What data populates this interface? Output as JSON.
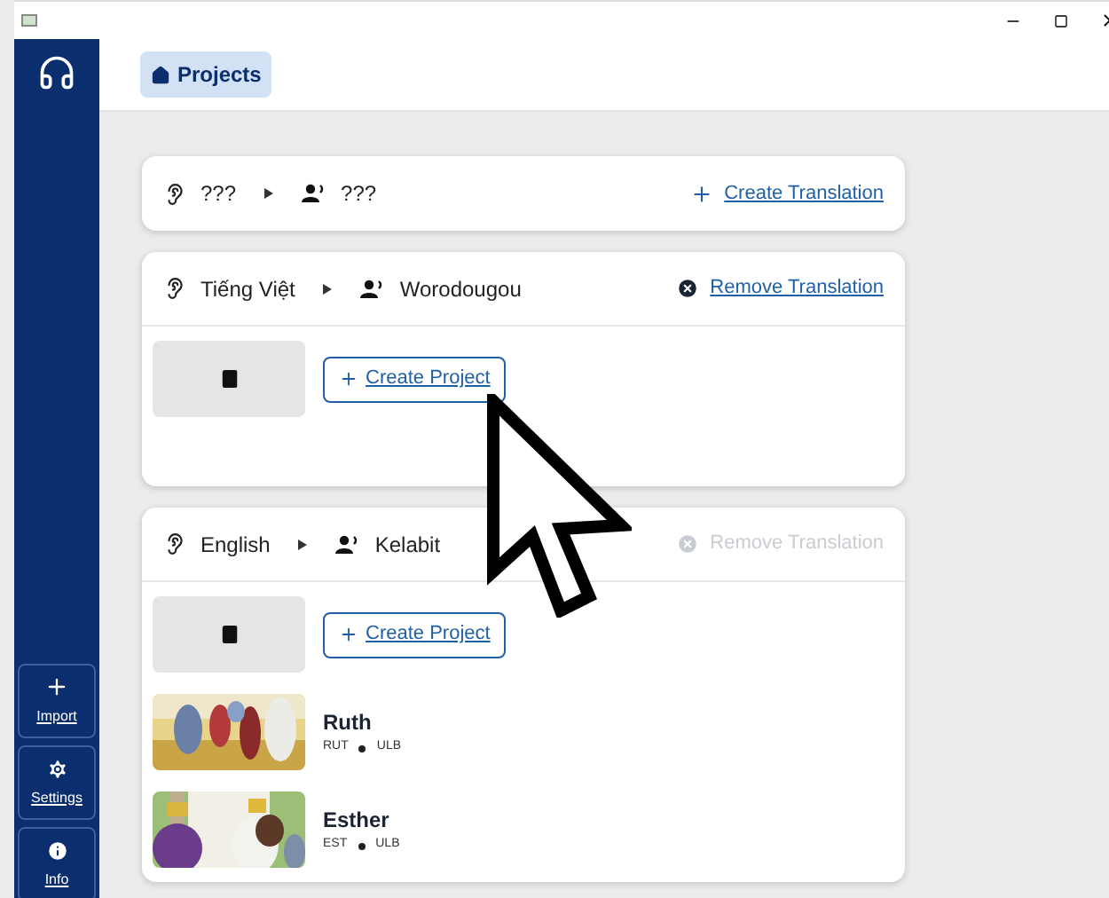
{
  "header": {
    "nav_button": "Projects"
  },
  "sidebar": {
    "buttons": [
      {
        "kind": "import",
        "label": "Import"
      },
      {
        "kind": "settings",
        "label": "Settings"
      },
      {
        "kind": "info",
        "label": "Info"
      }
    ]
  },
  "translations": [
    {
      "source": "???",
      "target": "???",
      "action": {
        "kind": "create",
        "label": "Create Translation",
        "disabled": false
      }
    },
    {
      "source": "Tiếng Việt",
      "target": "Worodougou",
      "action": {
        "kind": "remove",
        "label": "Remove Translation",
        "disabled": false
      },
      "create_project": "Create Project"
    },
    {
      "source": "English",
      "target": "Kelabit",
      "action": {
        "kind": "remove",
        "label": "Remove Translation",
        "disabled": true
      },
      "create_project": "Create Project",
      "projects": [
        {
          "title": "Ruth",
          "code": "RUT",
          "version": "ULB"
        },
        {
          "title": "Esther",
          "code": "EST",
          "version": "ULB"
        }
      ]
    }
  ]
}
